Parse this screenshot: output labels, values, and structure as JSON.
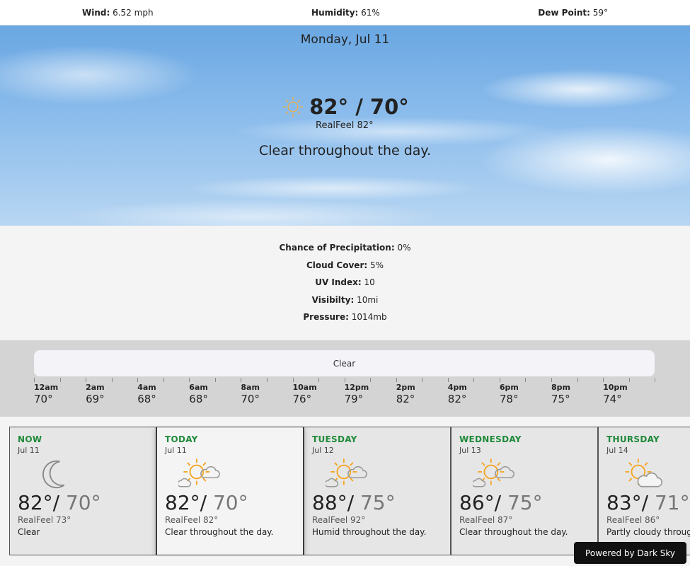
{
  "topbar": {
    "wind_label": "Wind:",
    "wind_value": "6.52 mph",
    "humidity_label": "Humidity:",
    "humidity_value": "61%",
    "dew_label": "Dew Point:",
    "dew_value": "59°"
  },
  "hero": {
    "date": "Monday, Jul 11",
    "temps": "82° / 70°",
    "realfeel": "RealFeel 82°",
    "summary": "Clear throughout the day.",
    "icon": "sun-icon"
  },
  "details": [
    {
      "label": "Chance of Precipitation:",
      "value": "0%"
    },
    {
      "label": "Cloud Cover:",
      "value": "5%"
    },
    {
      "label": "UV Index:",
      "value": "10"
    },
    {
      "label": "Visibilty:",
      "value": "10mi"
    },
    {
      "label": "Pressure:",
      "value": "1014mb"
    }
  ],
  "timeline": {
    "condition": "Clear",
    "hours": [
      {
        "time": "12am",
        "temp": "70°"
      },
      {
        "time": "2am",
        "temp": "69°"
      },
      {
        "time": "4am",
        "temp": "68°"
      },
      {
        "time": "6am",
        "temp": "68°"
      },
      {
        "time": "8am",
        "temp": "70°"
      },
      {
        "time": "10am",
        "temp": "76°"
      },
      {
        "time": "12pm",
        "temp": "79°"
      },
      {
        "time": "2pm",
        "temp": "82°"
      },
      {
        "time": "4pm",
        "temp": "82°"
      },
      {
        "time": "6pm",
        "temp": "78°"
      },
      {
        "time": "8pm",
        "temp": "75°"
      },
      {
        "time": "10pm",
        "temp": "74°"
      }
    ]
  },
  "cards": [
    {
      "day": "NOW",
      "date": "Jul 11",
      "hi": "82°/",
      "lo": "70°",
      "realfeel": "RealFeel 73°",
      "summary": "Clear",
      "icon": "moon-icon"
    },
    {
      "day": "TODAY",
      "date": "Jul 11",
      "hi": "82°/",
      "lo": "70°",
      "realfeel": "RealFeel 82°",
      "summary": "Clear throughout the day.",
      "icon": "partly-sunny-icon"
    },
    {
      "day": "TUESDAY",
      "date": "Jul 12",
      "hi": "88°/",
      "lo": "75°",
      "realfeel": "RealFeel 92°",
      "summary": "Humid throughout the day.",
      "icon": "partly-sunny-icon"
    },
    {
      "day": "WEDNESDAY",
      "date": "Jul 13",
      "hi": "86°/",
      "lo": "75°",
      "realfeel": "RealFeel 87°",
      "summary": "Clear throughout the day.",
      "icon": "partly-sunny-icon"
    },
    {
      "day": "THURSDAY",
      "date": "Jul 14",
      "hi": "83°/",
      "lo": "71°",
      "realfeel": "RealFeel 86°",
      "summary": "Partly cloudy throughout the day.",
      "icon": "partly-cloudy-icon"
    }
  ],
  "powered_by": "Powered by Dark Sky",
  "colors": {
    "day_label": "#1f8a3a",
    "sun": "#f5a623"
  }
}
